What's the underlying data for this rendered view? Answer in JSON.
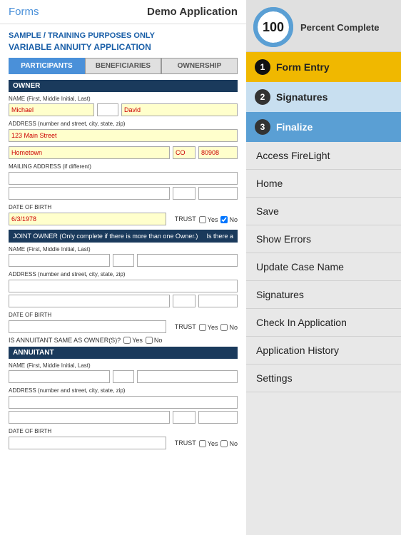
{
  "header": {
    "forms_label": "Forms",
    "app_title": "Demo Application"
  },
  "form": {
    "sample_notice": "SAMPLE / TRAINING PURPOSES ONLY",
    "app_subtitle": "VARIABLE ANNUITY APPLICATION",
    "tabs": [
      {
        "id": "participants",
        "label": "PARTICIPANTS",
        "active": true
      },
      {
        "id": "beneficiaries",
        "label": "BENEFICIARIES",
        "active": false
      },
      {
        "id": "ownership",
        "label": "OWNERSHIP",
        "active": false
      }
    ],
    "owner_section": "OWNER",
    "name_label": "NAME (First, Middle Initial, Last)",
    "owner_first": "Michael",
    "owner_middle": "",
    "owner_last": "David",
    "address_label": "ADDRESS (number and street, city, state, zip)",
    "owner_address": "123 Main Street",
    "owner_city": "Hometown",
    "owner_state": "CO",
    "owner_zip": "80908",
    "mailing_label": "MAILING ADDRESS (if different)",
    "dob_label": "DATE OF BIRTH",
    "owner_dob": "6/3/1978",
    "trust_label": "TRUST",
    "trust_yes": "Yes",
    "trust_no": "No",
    "joint_owner_label": "JOINT OWNER (Only complete if there is more than one Owner.)",
    "joint_is_there": "Is there a",
    "same_owner_label": "IS ANNUITANT SAME AS OWNER(S)?",
    "same_yes": "Yes",
    "same_no": "No",
    "annuitant_label": "ANNUITANT"
  },
  "progress": {
    "percent": "100",
    "percent_label": "Percent Complete"
  },
  "steps": [
    {
      "id": "form-entry",
      "number": "1",
      "label": "Form Entry",
      "state": "active"
    },
    {
      "id": "signatures",
      "number": "2",
      "label": "Signatures",
      "state": "normal"
    },
    {
      "id": "finalize",
      "number": "3",
      "label": "Finalize",
      "state": "current"
    }
  ],
  "menu": [
    {
      "id": "access-firelight",
      "label": "Access FireLight"
    },
    {
      "id": "home",
      "label": "Home"
    },
    {
      "id": "save",
      "label": "Save"
    },
    {
      "id": "show-errors",
      "label": "Show Errors"
    },
    {
      "id": "update-case-name",
      "label": "Update Case Name"
    },
    {
      "id": "signatures",
      "label": "Signatures"
    },
    {
      "id": "check-in-application",
      "label": "Check In Application"
    },
    {
      "id": "application-history",
      "label": "Application History"
    },
    {
      "id": "settings",
      "label": "Settings"
    }
  ]
}
